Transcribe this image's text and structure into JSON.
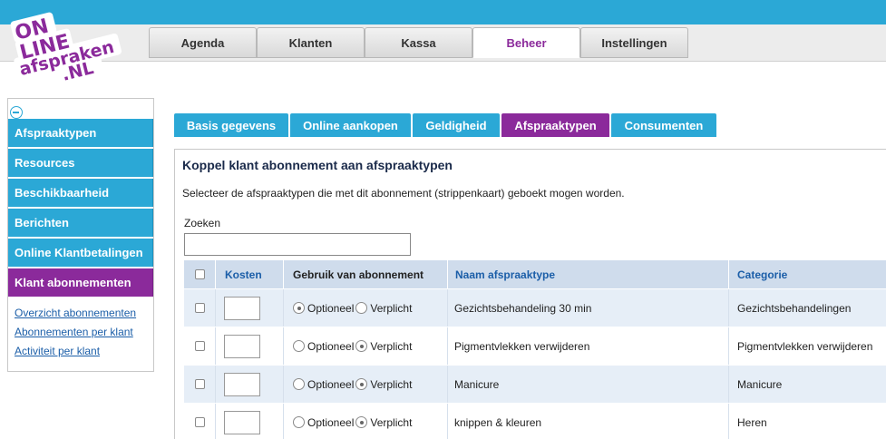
{
  "logo": {
    "line1": "ON",
    "line2": "LINE",
    "line3": "afspraken",
    "line4": ".NL"
  },
  "main_nav": [
    {
      "label": "Agenda",
      "active": false
    },
    {
      "label": "Klanten",
      "active": false
    },
    {
      "label": "Kassa",
      "active": false
    },
    {
      "label": "Beheer",
      "active": true
    },
    {
      "label": "Instellingen",
      "active": false
    }
  ],
  "sidebar": {
    "items": [
      {
        "label": "Afspraaktypen",
        "active": false
      },
      {
        "label": "Resources",
        "active": false
      },
      {
        "label": "Beschikbaarheid",
        "active": false
      },
      {
        "label": "Berichten",
        "active": false
      },
      {
        "label": "Online Klantbetalingen",
        "active": false
      },
      {
        "label": "Klant abonnementen",
        "active": true
      }
    ],
    "links": [
      "Overzicht abonnementen",
      "Abonnementen per klant",
      "Activiteit per klant"
    ]
  },
  "sub_tabs": [
    {
      "label": "Basis gegevens",
      "active": false
    },
    {
      "label": "Online aankopen",
      "active": false
    },
    {
      "label": "Geldigheid",
      "active": false
    },
    {
      "label": "Afspraaktypen",
      "active": true
    },
    {
      "label": "Consumenten",
      "active": false
    }
  ],
  "content": {
    "title": "Koppel klant abonnement aan afspraaktypen",
    "description": "Selecteer de afspraaktypen die met dit abonnement (strippenkaart) geboekt mogen worden.",
    "search_label": "Zoeken",
    "search_value": ""
  },
  "table": {
    "headers": {
      "kosten": "Kosten",
      "gebruik": "Gebruik van abonnement",
      "naam": "Naam afspraaktype",
      "categorie": "Categorie"
    },
    "option_labels": {
      "optional": "Optioneel",
      "required": "Verplicht"
    },
    "rows": [
      {
        "naam": "Gezichtsbehandeling 30 min",
        "categorie": "Gezichtsbehandelingen",
        "selected": "optional",
        "checked": false,
        "kosten": ""
      },
      {
        "naam": "Pigmentvlekken verwijderen",
        "categorie": "Pigmentvlekken verwijderen",
        "selected": "required",
        "checked": false,
        "kosten": ""
      },
      {
        "naam": "Manicure",
        "categorie": "Manicure",
        "selected": "required",
        "checked": false,
        "kosten": ""
      },
      {
        "naam": "knippen & kleuren",
        "categorie": "Heren",
        "selected": "required",
        "checked": false,
        "kosten": ""
      }
    ]
  },
  "colors": {
    "accent": "#2ba8d6",
    "active": "#8b2a9b",
    "link": "#1b5ea8"
  }
}
